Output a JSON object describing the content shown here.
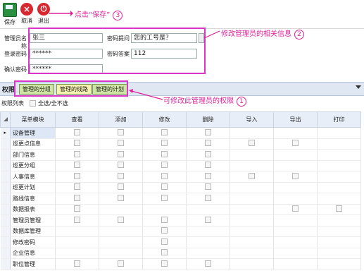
{
  "toolbar": {
    "save_label": "保存",
    "cancel_label": "取消",
    "exit_label": "退出",
    "cancel_icon": "×",
    "exit_icon": "⏻"
  },
  "annotations": {
    "save": "点击“保存”",
    "save_num": "3",
    "edit": "修改管理员的相关信息",
    "edit_num": "2",
    "perm": "可修改此管理员的权限",
    "perm_num": "1",
    "color": "#e0209a"
  },
  "form": {
    "name_label": "管理员名称",
    "name_value": "张三",
    "pwd_label": "登录密码",
    "pwd_value": "******",
    "confirm_label": "确认密码",
    "confirm_value": "******",
    "question_label": "密码提问",
    "question_value": "您的工号是？",
    "answer_label": "密码答案",
    "answer_value": "112"
  },
  "perm": {
    "title": "权限",
    "tabs": [
      "管理的分组",
      "管理的线路",
      "管理的计划"
    ],
    "active_tab": 1
  },
  "list": {
    "title": "权限列表",
    "select_all": "全选/全不选"
  },
  "grid": {
    "headers": [
      "菜单模块",
      "查看",
      "添加",
      "修改",
      "删除",
      "导入",
      "导出",
      "打印"
    ],
    "rows": [
      {
        "name": "设备管理",
        "cb": [
          1,
          1,
          1,
          1,
          0,
          0,
          0
        ],
        "selected": true
      },
      {
        "name": "巡更点信息",
        "cb": [
          1,
          1,
          1,
          1,
          1,
          1,
          0
        ]
      },
      {
        "name": "部门信息",
        "cb": [
          1,
          1,
          1,
          1,
          0,
          0,
          0
        ]
      },
      {
        "name": "巡更分组",
        "cb": [
          1,
          1,
          1,
          1,
          0,
          0,
          0
        ]
      },
      {
        "name": "人事信息",
        "cb": [
          1,
          1,
          1,
          1,
          1,
          1,
          0
        ]
      },
      {
        "name": "巡更计划",
        "cb": [
          1,
          1,
          1,
          1,
          0,
          0,
          0
        ]
      },
      {
        "name": "路线信息",
        "cb": [
          1,
          1,
          1,
          1,
          0,
          0,
          0
        ]
      },
      {
        "name": "数据报表",
        "cb": [
          1,
          0,
          0,
          0,
          0,
          1,
          1
        ]
      },
      {
        "name": "管理员管理",
        "cb": [
          1,
          1,
          1,
          1,
          0,
          0,
          0
        ]
      },
      {
        "name": "数据库管理",
        "cb": [
          0,
          0,
          1,
          0,
          0,
          0,
          0
        ]
      },
      {
        "name": "修改密码",
        "cb": [
          0,
          0,
          1,
          0,
          0,
          0,
          0
        ]
      },
      {
        "name": "企业信息",
        "cb": [
          0,
          0,
          1,
          0,
          0,
          0,
          0
        ]
      },
      {
        "name": "职位管理",
        "cb": [
          1,
          1,
          1,
          1,
          0,
          0,
          0
        ]
      }
    ]
  }
}
